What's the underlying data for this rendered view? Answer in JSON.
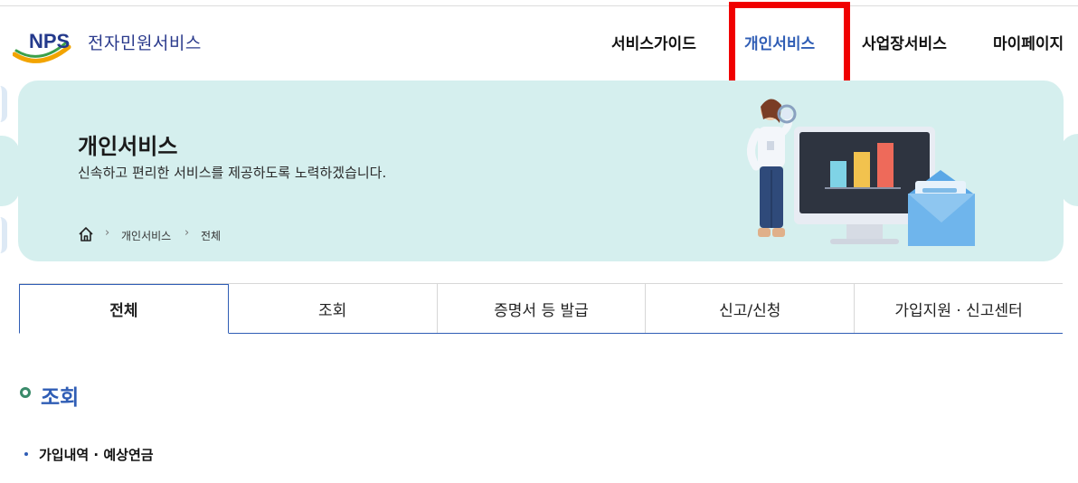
{
  "logo": {
    "brand": "NPS",
    "title": "전자민원서비스",
    "icon": "nps-swoosh-logo"
  },
  "nav": {
    "items": [
      {
        "label": "서비스가이드"
      },
      {
        "label": "개인서비스"
      },
      {
        "label": "사업장서비스"
      },
      {
        "label": "마이페이지"
      }
    ],
    "active_index": 1
  },
  "banner": {
    "title": "개인서비스",
    "subtitle": "신속하고 편리한 서비스를 제공하도록 노력하겠습니다.",
    "breadcrumb": {
      "home_icon": "home-icon",
      "items": [
        "개인서비스",
        "전체"
      ]
    }
  },
  "tabs": {
    "items": [
      "전체",
      "조회",
      "증명서 등 발급",
      "신고/신청",
      "가입지원 · 신고센터"
    ],
    "active_index": 0
  },
  "section": {
    "title": "조회",
    "items": [
      "가입내역 · 예상연금"
    ]
  },
  "colors": {
    "accent": "#2f5db5",
    "banner_bg": "#d5efee",
    "highlight": "#f00000"
  }
}
